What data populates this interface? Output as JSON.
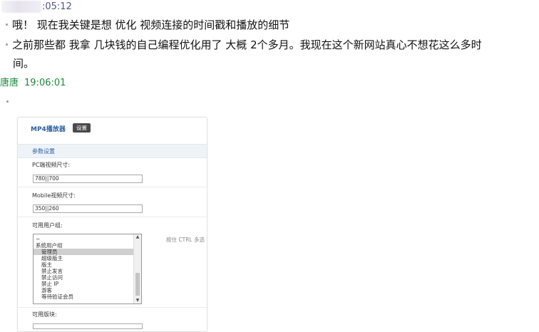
{
  "message1": {
    "time": ":05:12",
    "lines": [
      "哦！ 现在我关键是想  优化 视频连接的时间戳和播放的细节",
      "之前那些都 我拿 几块钱的自己编程优化用了 大概  2个多月。我现在这个新网站真心不想花这么多时",
      "间。"
    ]
  },
  "message2": {
    "sender": "唐唐",
    "time": "19:06:01"
  },
  "screenshot": {
    "title": "MP4播放器",
    "settings_button": "设置",
    "section": "参数设置",
    "pc_label": "PC端视频尺寸:",
    "pc_value": "780||700",
    "mobile_label": "Mobile视频尺寸:",
    "mobile_value": "350||260",
    "groups_label": "可用用户组:",
    "groups_hint": "按住 CTRL 多选",
    "group_options": [
      "~",
      "系统用户组",
      "管理员",
      "超级版主",
      "版主",
      "禁止发言",
      "禁止访问",
      "禁止 IP",
      "游客",
      "等待验证会员"
    ],
    "selected_option": "管理员",
    "forums_label": "可用版块:"
  }
}
